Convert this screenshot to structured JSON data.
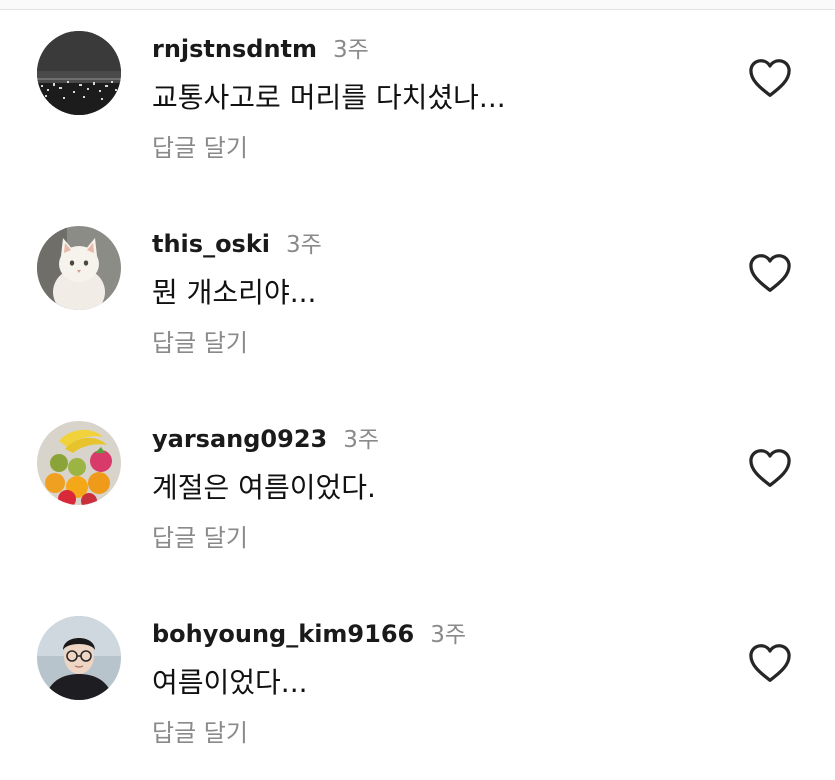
{
  "comments": [
    {
      "username": "rnjstnsdntm",
      "time": "3주",
      "text": "교통사고로 머리를 다치셨나...",
      "reply_label": "답글 달기",
      "avatar": "city-night-skyline-avatar"
    },
    {
      "username": "this_oski",
      "time": "3주",
      "text": "뭔 개소리야...",
      "reply_label": "답글 달기",
      "avatar": "white-cat-avatar"
    },
    {
      "username": "yarsang0923",
      "time": "3주",
      "text": "계절은 여름이었다.",
      "reply_label": "답글 달기",
      "avatar": "fruit-bowl-avatar"
    },
    {
      "username": "bohyoung_kim9166",
      "time": "3주",
      "text": "여름이었다...",
      "reply_label": "답글 달기",
      "avatar": "person-with-glasses-avatar"
    }
  ],
  "icons": {
    "like": "heart-outline-icon"
  },
  "colors": {
    "username": "#1a1a1a",
    "meta": "#8a8a8a",
    "text": "#111111",
    "icon": "#262626"
  }
}
